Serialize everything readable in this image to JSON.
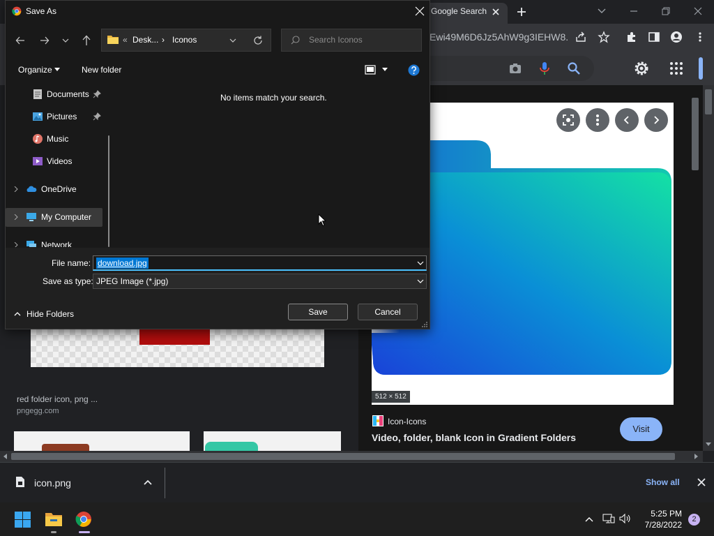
{
  "browser": {
    "tab_title": "Google Search",
    "url": "Ewi49M6D6Jz5AhW9g3IEHW8...",
    "accent": "#8ab4f8"
  },
  "results": {
    "left_caption": "red folder icon, png ...",
    "left_source": "pngegg.com"
  },
  "preview": {
    "dimensions": "512 × 512",
    "source_name": "Icon-Icons",
    "title": "Video, folder, blank Icon in Gradient Folders",
    "visit_label": "Visit"
  },
  "downloads": {
    "file_name": "icon.png",
    "show_all_label": "Show all"
  },
  "taskbar": {
    "time": "5:25 PM",
    "date": "7/28/2022",
    "notification_count": "2"
  },
  "dialog": {
    "title": "Save As",
    "address": {
      "lead": "«",
      "segment_1": "Desk...",
      "separator": "›",
      "segment_2": "Iconos"
    },
    "search_placeholder": "Search Iconos",
    "organize_label": "Organize",
    "new_folder_label": "New folder",
    "nav_items": [
      {
        "label": "Documents",
        "icon": "documents-icon",
        "pinned": true
      },
      {
        "label": "Pictures",
        "icon": "pictures-icon",
        "pinned": true
      },
      {
        "label": "Music",
        "icon": "music-icon",
        "pinned": false
      },
      {
        "label": "Videos",
        "icon": "videos-icon",
        "pinned": false
      },
      {
        "label": "OneDrive",
        "icon": "cloud-icon",
        "pinned": false
      },
      {
        "label": "My Computer",
        "icon": "computer-icon",
        "pinned": false
      },
      {
        "label": "Network",
        "icon": "network-icon",
        "pinned": false
      }
    ],
    "empty_message": "No items match your search.",
    "file_name_label": "File name:",
    "file_name_value": "download.jpg",
    "save_type_label": "Save as type:",
    "save_type_value": "JPEG Image (*.jpg)",
    "hide_folders_label": "Hide Folders",
    "save_label": "Save",
    "cancel_label": "Cancel"
  }
}
